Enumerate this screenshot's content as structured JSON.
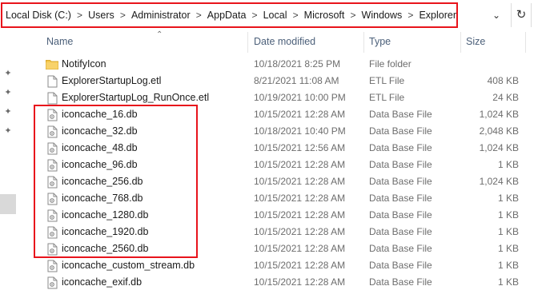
{
  "breadcrumb": {
    "items": [
      "Local Disk (C:)",
      "Users",
      "Administrator",
      "AppData",
      "Local",
      "Microsoft",
      "Windows",
      "Explorer"
    ],
    "separator": ">"
  },
  "columns": {
    "name": "Name",
    "date": "Date modified",
    "type": "Type",
    "size": "Size"
  },
  "files": [
    {
      "name": "NotifyIcon",
      "date": "10/18/2021 8:25 PM",
      "type": "File folder",
      "size": "",
      "icon": "folder-icon"
    },
    {
      "name": "ExplorerStartupLog.etl",
      "date": "8/21/2021 11:08 AM",
      "type": "ETL File",
      "size": "408 KB",
      "icon": "file-icon"
    },
    {
      "name": "ExplorerStartupLog_RunOnce.etl",
      "date": "10/19/2021 10:00 PM",
      "type": "ETL File",
      "size": "24 KB",
      "icon": "file-icon"
    },
    {
      "name": "iconcache_16.db",
      "date": "10/15/2021 12:28 AM",
      "type": "Data Base File",
      "size": "1,024 KB",
      "icon": "db-file-icon"
    },
    {
      "name": "iconcache_32.db",
      "date": "10/18/2021 10:40 PM",
      "type": "Data Base File",
      "size": "2,048 KB",
      "icon": "db-file-icon"
    },
    {
      "name": "iconcache_48.db",
      "date": "10/15/2021 12:56 AM",
      "type": "Data Base File",
      "size": "1,024 KB",
      "icon": "db-file-icon"
    },
    {
      "name": "iconcache_96.db",
      "date": "10/15/2021 12:28 AM",
      "type": "Data Base File",
      "size": "1 KB",
      "icon": "db-file-icon"
    },
    {
      "name": "iconcache_256.db",
      "date": "10/15/2021 12:28 AM",
      "type": "Data Base File",
      "size": "1,024 KB",
      "icon": "db-file-icon"
    },
    {
      "name": "iconcache_768.db",
      "date": "10/15/2021 12:28 AM",
      "type": "Data Base File",
      "size": "1 KB",
      "icon": "db-file-icon"
    },
    {
      "name": "iconcache_1280.db",
      "date": "10/15/2021 12:28 AM",
      "type": "Data Base File",
      "size": "1 KB",
      "icon": "db-file-icon"
    },
    {
      "name": "iconcache_1920.db",
      "date": "10/15/2021 12:28 AM",
      "type": "Data Base File",
      "size": "1 KB",
      "icon": "db-file-icon"
    },
    {
      "name": "iconcache_2560.db",
      "date": "10/15/2021 12:28 AM",
      "type": "Data Base File",
      "size": "1 KB",
      "icon": "db-file-icon"
    },
    {
      "name": "iconcache_custom_stream.db",
      "date": "10/15/2021 12:28 AM",
      "type": "Data Base File",
      "size": "1 KB",
      "icon": "db-file-icon"
    },
    {
      "name": "iconcache_exif.db",
      "date": "10/15/2021 12:28 AM",
      "type": "Data Base File",
      "size": "1 KB",
      "icon": "db-file-icon"
    }
  ],
  "colors": {
    "annotation_red": "#e8141c",
    "folder_yellow": "#f5c84b",
    "header_text": "#4c607a",
    "secondary_text": "#6d6d6d"
  }
}
